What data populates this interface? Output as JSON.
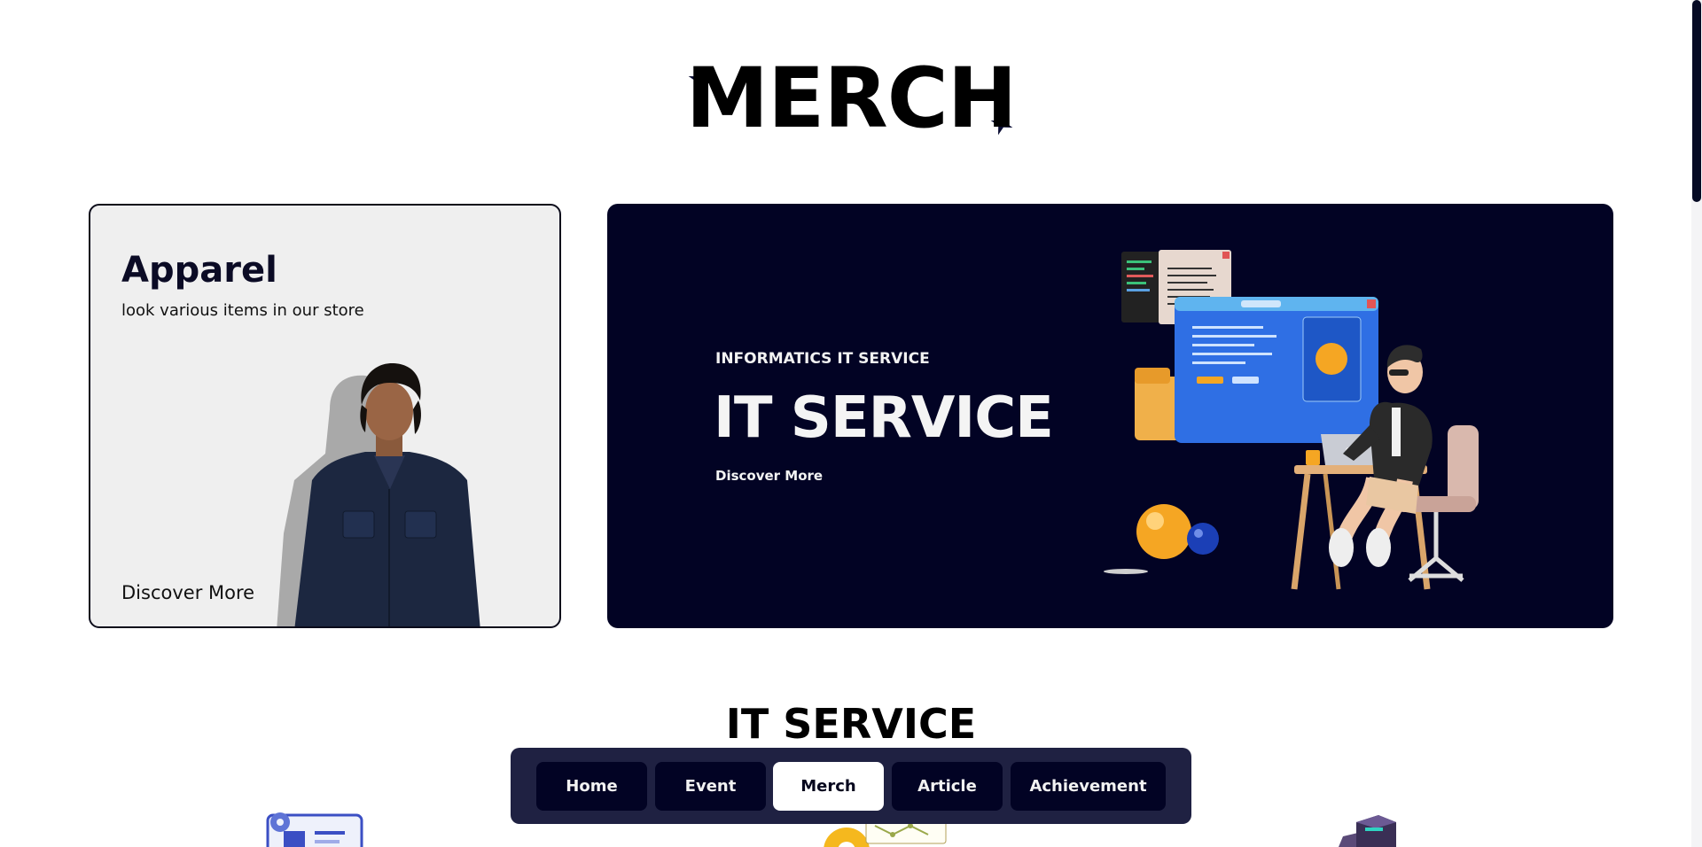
{
  "page": {
    "title": "MERCH",
    "section_title": "IT SERVICE"
  },
  "apparel_card": {
    "title": "Apparel",
    "subtitle": "look various items in our store",
    "link": "Discover More"
  },
  "it_card": {
    "eyebrow": "INFORMATICS IT SERVICE",
    "title": "IT SERVICE",
    "link": "Discover More"
  },
  "nav": {
    "items": [
      {
        "label": "Home",
        "active": false
      },
      {
        "label": "Event",
        "active": false
      },
      {
        "label": "Merch",
        "active": true
      },
      {
        "label": "Article",
        "active": false
      },
      {
        "label": "Achievement",
        "active": false
      }
    ]
  },
  "colors": {
    "navy": "#020324",
    "nav_bar": "#1f2142",
    "card_gray": "#efefef",
    "accent_orange": "#f5a623",
    "accent_blue": "#2f6fe4"
  },
  "icons": [
    "sparkle-icon",
    "gear-icon"
  ]
}
